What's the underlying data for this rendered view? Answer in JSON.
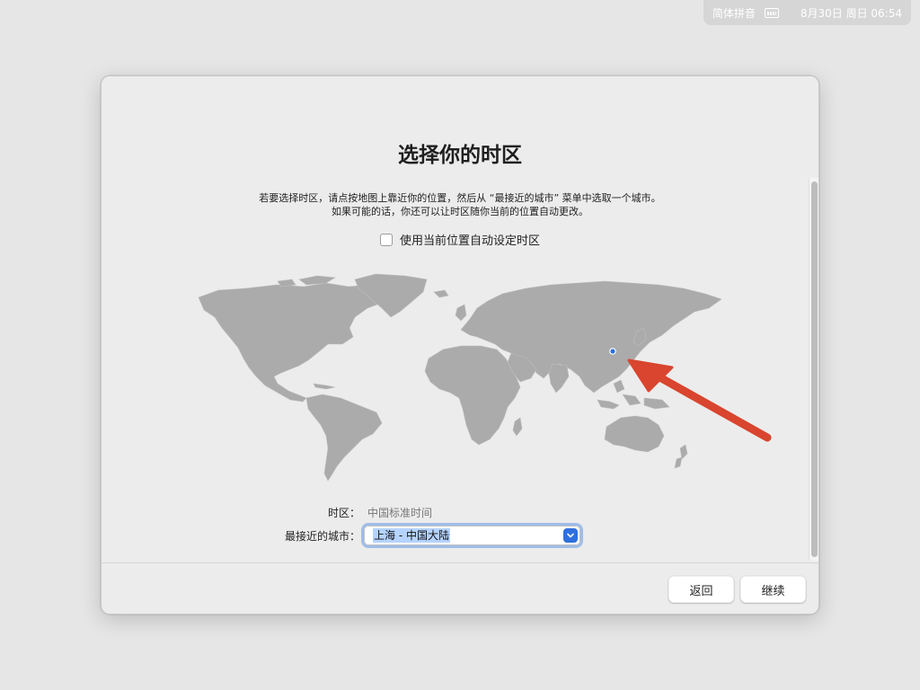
{
  "menubar": {
    "input_method": "简体拼音",
    "keyboard_icon": "keyboard-icon",
    "datetime": "8月30日 周日 06:54"
  },
  "setup": {
    "title": "选择你的时区",
    "description_line1": "若要选择时区，请点按地图上靠近你的位置，然后从 “最接近的城市” 菜单中选取一个城市。",
    "description_line2": "如果可能的话，你还可以让时区随你当前的位置自动更改。",
    "auto_timezone_label": "使用当前位置自动设定时区",
    "auto_timezone_checked": false,
    "timezone_label": "时区：",
    "timezone_value": "中国标准时间",
    "closest_city_label": "最接近的城市：",
    "closest_city_value": "上海 - 中国大陆"
  },
  "buttons": {
    "back": "返回",
    "continue": "继续"
  },
  "colors": {
    "map_land": "#ababab",
    "location_pin": "#2f6fdd",
    "annotation_arrow": "#d9452e",
    "accent": "#2f6fdd"
  }
}
